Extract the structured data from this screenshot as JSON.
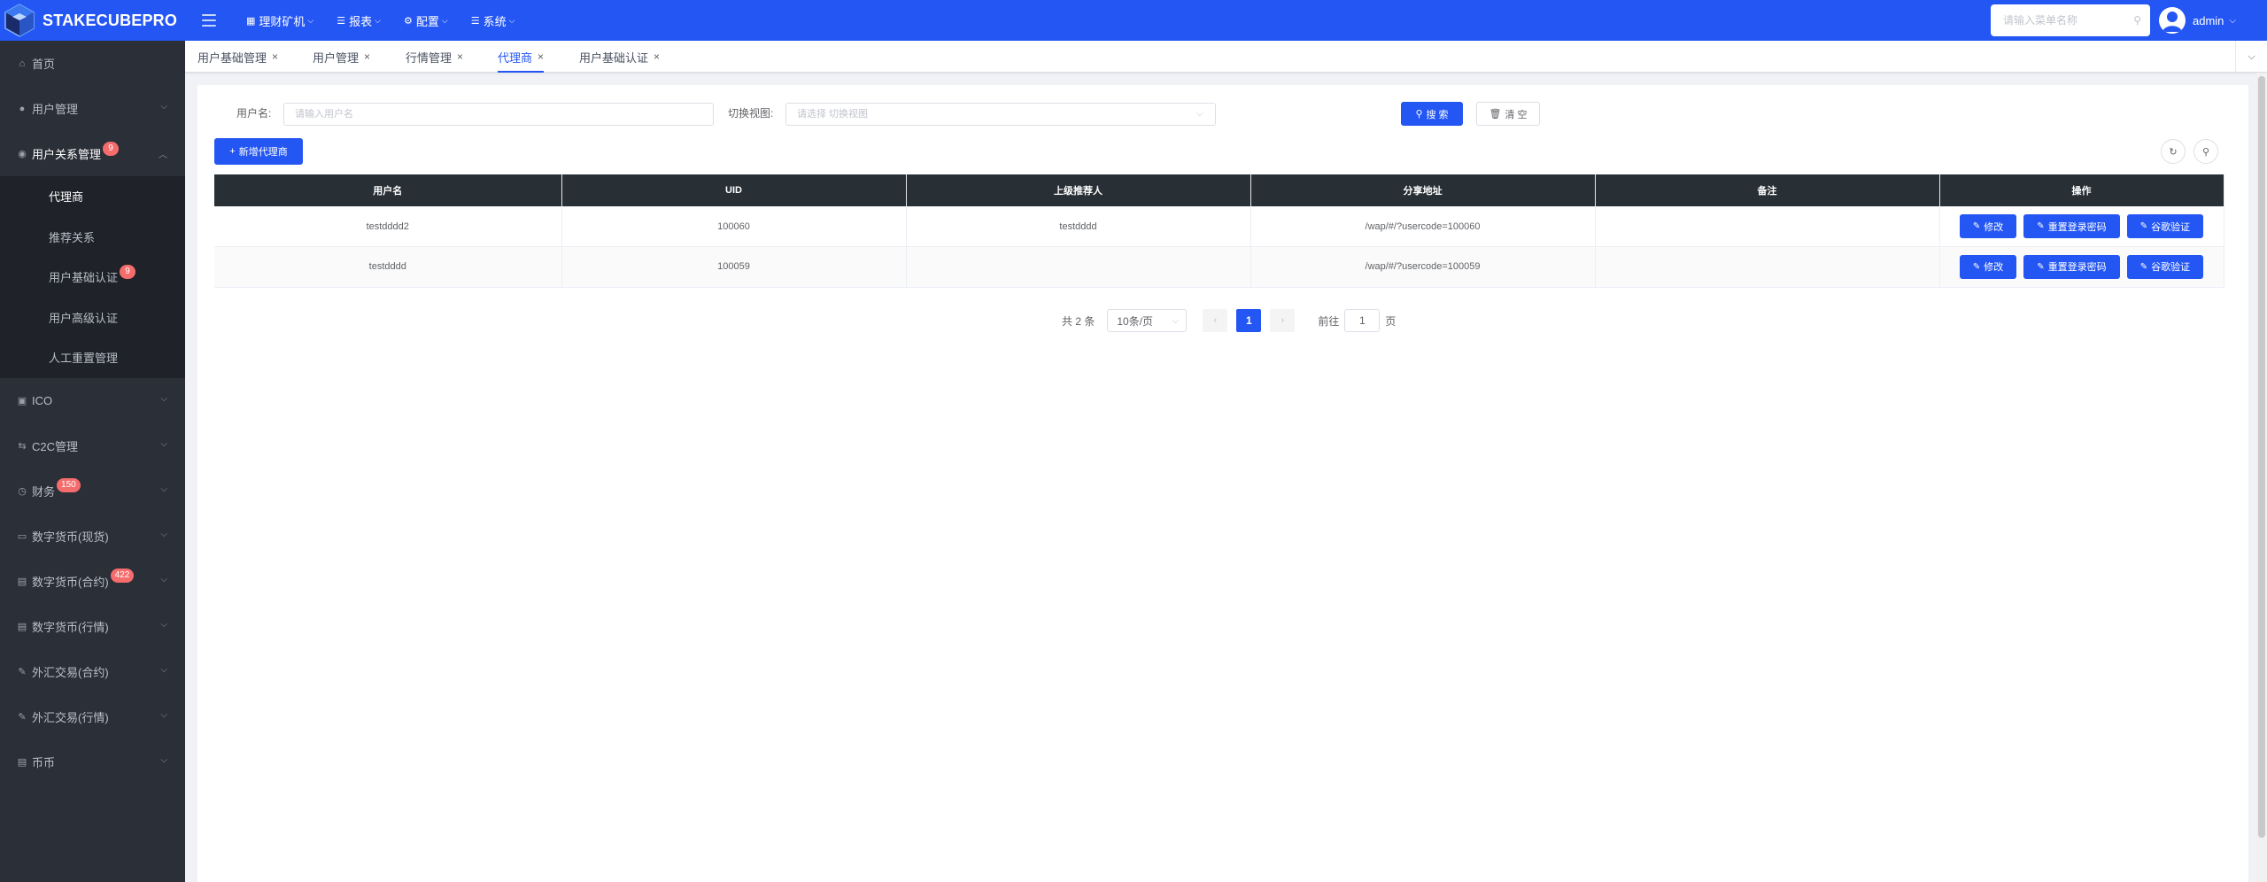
{
  "brand": {
    "name": "STAKECUBEPRO",
    "color": "#2456f3"
  },
  "topnav": [
    {
      "icon": "grid-icon",
      "label": "理财矿机"
    },
    {
      "icon": "list-icon",
      "label": "报表"
    },
    {
      "icon": "gear-icon",
      "label": "配置"
    },
    {
      "icon": "list-icon",
      "label": "系统"
    }
  ],
  "header_search": {
    "placeholder": "请输入菜单名称"
  },
  "user": {
    "name": "admin"
  },
  "sidebar": {
    "items": [
      {
        "icon": "home-icon",
        "label": "首页",
        "expandable": false
      },
      {
        "icon": "user-icon",
        "label": "用户管理",
        "expandable": true
      },
      {
        "icon": "user-circle-icon",
        "label": "用户关系管理",
        "badge": "9",
        "expandable": true,
        "open": true
      },
      {
        "icon": "box-icon",
        "label": "ICO",
        "expandable": true
      },
      {
        "icon": "swap-icon",
        "label": "C2C管理",
        "expandable": true
      },
      {
        "icon": "clock-icon",
        "label": "财务",
        "badge": "150",
        "expandable": true
      },
      {
        "icon": "wallet-icon",
        "label": "数字货币(现货)",
        "expandable": true
      },
      {
        "icon": "doc-icon",
        "label": "数字货币(合约)",
        "badge": "422",
        "expandable": true
      },
      {
        "icon": "doc-icon",
        "label": "数字货币(行情)",
        "expandable": true
      },
      {
        "icon": "edit-doc-icon",
        "label": "外汇交易(合约)",
        "expandable": true
      },
      {
        "icon": "edit-doc-icon",
        "label": "外汇交易(行情)",
        "expandable": true
      },
      {
        "icon": "doc-icon",
        "label": "币币",
        "expandable": true
      }
    ],
    "submenu": [
      {
        "label": "代理商",
        "active": true
      },
      {
        "label": "推荐关系",
        "active": false
      },
      {
        "label": "用户基础认证",
        "badge": "9",
        "active": false
      },
      {
        "label": "用户高级认证",
        "active": false
      },
      {
        "label": "人工重置管理",
        "active": false
      }
    ]
  },
  "tags": [
    {
      "label": "用户基础管理",
      "active": false
    },
    {
      "label": "用户管理",
      "active": false
    },
    {
      "label": "行情管理",
      "active": false
    },
    {
      "label": "代理商",
      "active": true
    },
    {
      "label": "用户基础认证",
      "active": false
    }
  ],
  "filters": {
    "username_label": "用户名:",
    "username_placeholder": "请输入用户名",
    "view_label": "切换视图:",
    "view_placeholder": "请选择 切换视图",
    "search_label": "搜 索",
    "clear_label": "清 空"
  },
  "add_button_label": "新增代理商",
  "table": {
    "headers": [
      "用户名",
      "UID",
      "上级推荐人",
      "分享地址",
      "备注",
      "操作"
    ],
    "rows": [
      {
        "username": "testdddd2",
        "uid": "100060",
        "referrer": "testdddd",
        "share_url": "/wap/#/?usercode=100060",
        "remark": ""
      },
      {
        "username": "testdddd",
        "uid": "100059",
        "referrer": "",
        "share_url": "/wap/#/?usercode=100059",
        "remark": ""
      }
    ],
    "actions": {
      "edit": "修改",
      "reset_password": "重置登录密码",
      "google_auth": "谷歌验证"
    }
  },
  "pagination": {
    "total_text": "共 2 条",
    "page_size": "10条/页",
    "current_page": "1",
    "goto_prefix": "前往",
    "goto_value": "1",
    "goto_suffix": "页"
  }
}
